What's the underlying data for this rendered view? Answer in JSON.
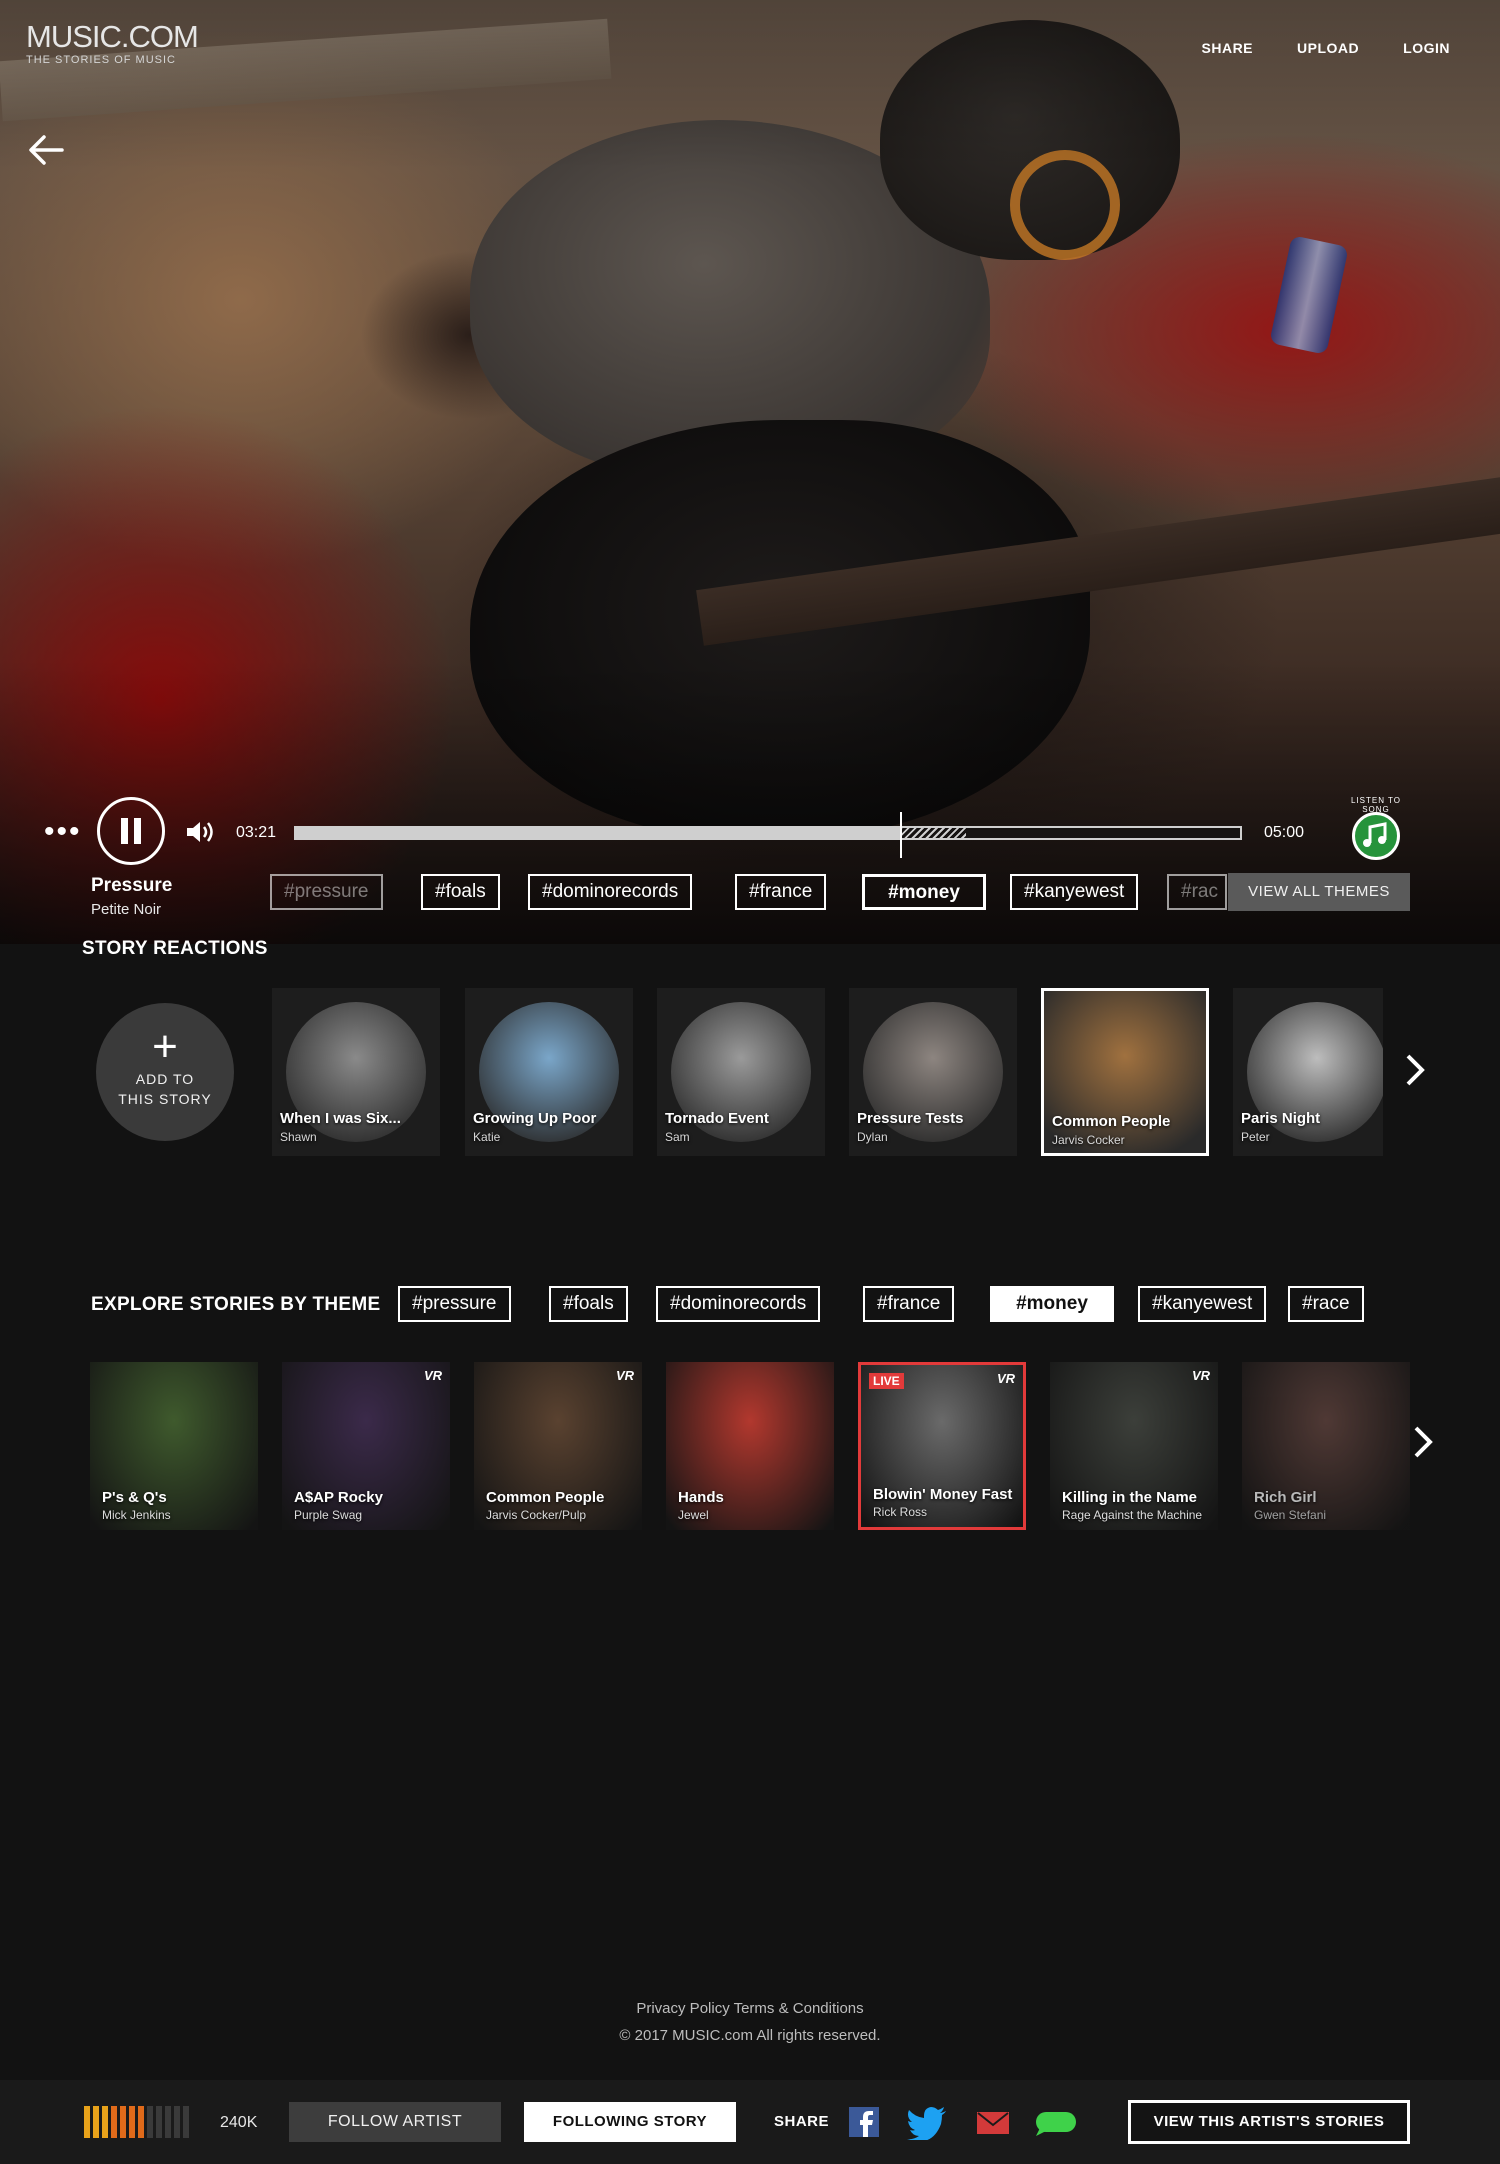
{
  "brand": {
    "title": "MUSIC.COM",
    "tagline": "THE STORIES OF MUSIC"
  },
  "nav": {
    "share": "SHARE",
    "upload": "UPLOAD",
    "login": "LOGIN"
  },
  "player": {
    "current_time": "03:21",
    "total_time": "05:00",
    "progress_fraction": 0.64,
    "buffered_to_fraction": 0.71,
    "listen_label": "LISTEN TO SONG",
    "song_title": "Pressure",
    "song_artist": "Petite Noir"
  },
  "themes": {
    "tags": [
      "#pressure",
      "#foals",
      "#dominorecords",
      "#france",
      "#money",
      "#kanyewest",
      "#rac"
    ],
    "active": "#money",
    "view_all_label": "VIEW ALL THEMES"
  },
  "reactions": {
    "title": "STORY REACTIONS",
    "add_label_1": "ADD TO",
    "add_label_2": "THIS STORY",
    "items": [
      {
        "title": "When I was Six...",
        "author": "Shawn",
        "color": "#8a8a8a"
      },
      {
        "title": "Growing Up Poor",
        "author": "Katie",
        "color": "#7aa6c9"
      },
      {
        "title": "Tornado Event",
        "author": "Sam",
        "color": "#9a9a9a"
      },
      {
        "title": "Pressure Tests",
        "author": "Dylan",
        "color": "#8d8580"
      },
      {
        "title": "Common People",
        "author": "Jarvis Cocker",
        "color": "#a0713f"
      },
      {
        "title": "Paris Night",
        "author": "Peter",
        "color": "#bdbdbd"
      }
    ]
  },
  "explore": {
    "title": "EXPLORE STORIES BY THEME",
    "tags": [
      "#pressure",
      "#foals",
      "#dominorecords",
      "#france",
      "#money",
      "#kanyewest",
      "#race"
    ],
    "active": "#money",
    "cards": [
      {
        "title": "P's & Q's",
        "artist": "Mick Jenkins",
        "vr": false,
        "live": false,
        "color": "#3f5a2d"
      },
      {
        "title": "A$AP Rocky",
        "artist": "Purple Swag",
        "vr": true,
        "live": false,
        "color": "#3b2a4a"
      },
      {
        "title": "Common People",
        "artist": "Jarvis Cocker/Pulp",
        "vr": true,
        "live": false,
        "color": "#5a4230"
      },
      {
        "title": "Hands",
        "artist": "Jewel",
        "vr": false,
        "live": false,
        "color": "#b2382e"
      },
      {
        "title": "Blowin' Money Fast",
        "artist": "Rick Ross",
        "vr": true,
        "live": true,
        "color": "#6a6a6a"
      },
      {
        "title": "Killing in the Name",
        "artist": "Rage Against the Machine",
        "vr": true,
        "live": false,
        "color": "#3c3f3a"
      },
      {
        "title": "Rich Girl",
        "artist": "Gwen Stefani",
        "vr": false,
        "live": false,
        "color": "#6a4a44"
      }
    ],
    "vr_label": "VR",
    "live_label": "LIVE"
  },
  "footer": {
    "links": "Privacy Policy Terms & Conditions",
    "copyright": "© 2017 MUSIC.com All rights reserved."
  },
  "bottom_bar": {
    "follower_count": "240K",
    "follow_artist": "FOLLOW ARTIST",
    "following_story": "FOLLOWING STORY",
    "share_label": "SHARE",
    "view_artist_stories": "VIEW THIS ARTIST'S STORIES",
    "meter_level": 0.55
  },
  "colors": {
    "accent_live": "#e23a3a",
    "listen_green": "#26933b",
    "facebook": "#3b5998",
    "twitter": "#1da1f2",
    "mail": "#d33a3a",
    "message": "#3fd24a"
  }
}
